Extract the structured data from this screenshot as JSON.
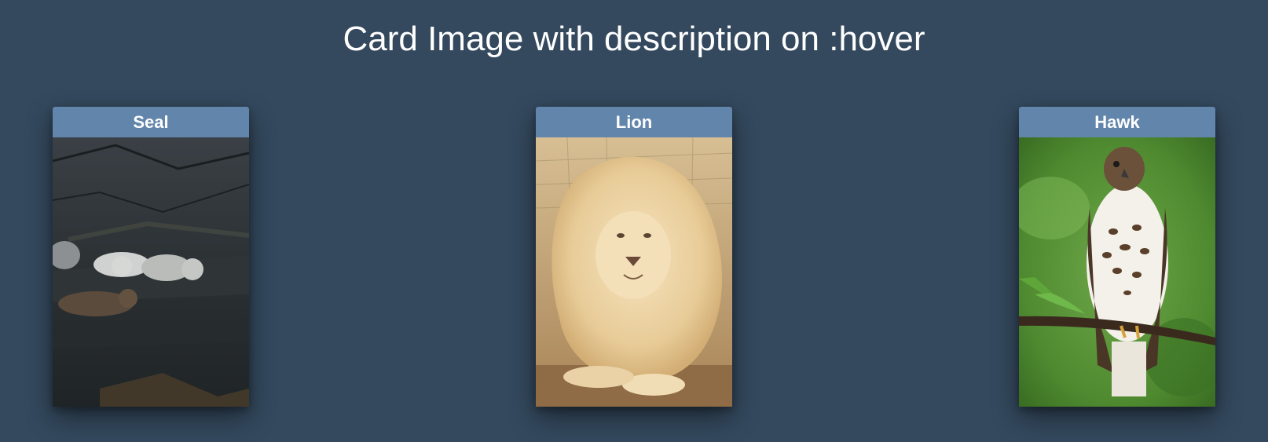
{
  "page": {
    "title": "Card Image with description on :hover"
  },
  "cards": [
    {
      "label": "Seal",
      "image": "seals-on-rock-photo"
    },
    {
      "label": "Lion",
      "image": "white-lion-photo"
    },
    {
      "label": "Hawk",
      "image": "hawk-on-branch-photo"
    }
  ],
  "colors": {
    "background": "#34495e",
    "card_header": "#6285ac",
    "text": "#ffffff"
  }
}
